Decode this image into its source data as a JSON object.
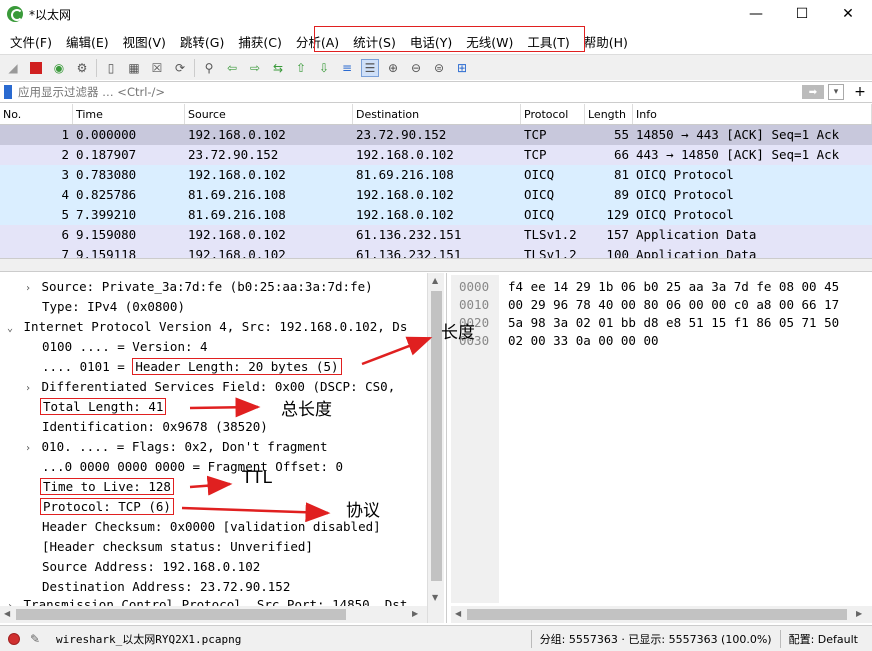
{
  "window": {
    "title": "*以太网",
    "minimize": "—",
    "maximize": "☐",
    "close": "✕"
  },
  "menu": [
    "文件(F)",
    "编辑(E)",
    "视图(V)",
    "跳转(G)",
    "捕获(C)",
    "分析(A)",
    "统计(S)",
    "电话(Y)",
    "无线(W)",
    "工具(T)",
    "帮助(H)"
  ],
  "filter": {
    "placeholder": "应用显示过滤器 … <Ctrl-/>"
  },
  "packet_list": {
    "columns": [
      "No.",
      "Time",
      "Source",
      "Destination",
      "Protocol",
      "Length",
      "Info"
    ],
    "rows": [
      {
        "no": "1",
        "time": "0.000000",
        "src": "192.168.0.102",
        "dst": "23.72.90.152",
        "proto": "TCP",
        "len": "55",
        "info": "14850 → 443 [ACK] Seq=1 Ack",
        "bg": "#c8c8dc"
      },
      {
        "no": "2",
        "time": "0.187907",
        "src": "23.72.90.152",
        "dst": "192.168.0.102",
        "proto": "TCP",
        "len": "66",
        "info": "443 → 14850 [ACK] Seq=1 Ack",
        "bg": "#e4e4f8"
      },
      {
        "no": "3",
        "time": "0.783080",
        "src": "192.168.0.102",
        "dst": "81.69.216.108",
        "proto": "OICQ",
        "len": "81",
        "info": "OICQ Protocol",
        "bg": "#daeeff"
      },
      {
        "no": "4",
        "time": "0.825786",
        "src": "81.69.216.108",
        "dst": "192.168.0.102",
        "proto": "OICQ",
        "len": "89",
        "info": "OICQ Protocol",
        "bg": "#daeeff"
      },
      {
        "no": "5",
        "time": "7.399210",
        "src": "81.69.216.108",
        "dst": "192.168.0.102",
        "proto": "OICQ",
        "len": "129",
        "info": "OICQ Protocol",
        "bg": "#daeeff"
      },
      {
        "no": "6",
        "time": "9.159080",
        "src": "192.168.0.102",
        "dst": "61.136.232.151",
        "proto": "TLSv1.2",
        "len": "157",
        "info": "Application Data",
        "bg": "#e4e4f8"
      },
      {
        "no": "7",
        "time": "9.159118",
        "src": "192.168.0.102",
        "dst": "61.136.232.151",
        "proto": "TLSv1.2",
        "len": "100",
        "info": "Application Data",
        "bg": "#e4e4f8"
      }
    ]
  },
  "details": {
    "l1": "Source: Private_3a:7d:fe (b0:25:aa:3a:7d:fe)",
    "l2": "Type: IPv4 (0x0800)",
    "l3": "Internet Protocol Version 4, Src: 192.168.0.102, Ds",
    "l4": "0100 .... = Version: 4",
    "l5_prefix": ".... 0101 = ",
    "l5_boxed": "Header Length: 20 bytes (5)",
    "l6": "Differentiated Services Field: 0x00 (DSCP: CS0,",
    "l7": "Total Length: 41",
    "l8": "Identification: 0x9678 (38520)",
    "l9": "010. .... = Flags: 0x2, Don't fragment",
    "l10": "...0 0000 0000 0000 = Fragment Offset: 0",
    "l11": "Time to Live: 128",
    "l12": "Protocol: TCP (6)",
    "l13": "Header Checksum: 0x0000 [validation disabled]",
    "l14": "[Header checksum status: Unverified]",
    "l15": "Source Address: 192.168.0.102",
    "l16": "Destination Address: 23.72.90.152",
    "l17": "Transmission Control Protocol, Src Port: 14850, Dst"
  },
  "bytes": {
    "offsets": [
      "0000",
      "0010",
      "0020",
      "0030"
    ],
    "hex": [
      "f4 ee 14 29 1b 06 b0 25  aa 3a 7d fe 08 00 45",
      "00 29 96 78 40 00 80 06  00 00 c0 a8 00 66 17",
      "5a 98 3a 02 01 bb d8 e8  51 15 f1 86 05 71 50",
      "02 00 33 0a 00 00 00"
    ]
  },
  "annotations": {
    "header_length": "长度",
    "total_length": "总长度",
    "ttl": "TTL",
    "protocol": "协议"
  },
  "status": {
    "file": "wireshark_以太网RYQ2X1.pcapng",
    "packets": "分组: 5557363 · 已显示: 5557363 (100.0%)",
    "profile": "配置: Default"
  },
  "colors": {
    "accent_red": "#e02020",
    "selected_row": "#c8c8dc"
  }
}
